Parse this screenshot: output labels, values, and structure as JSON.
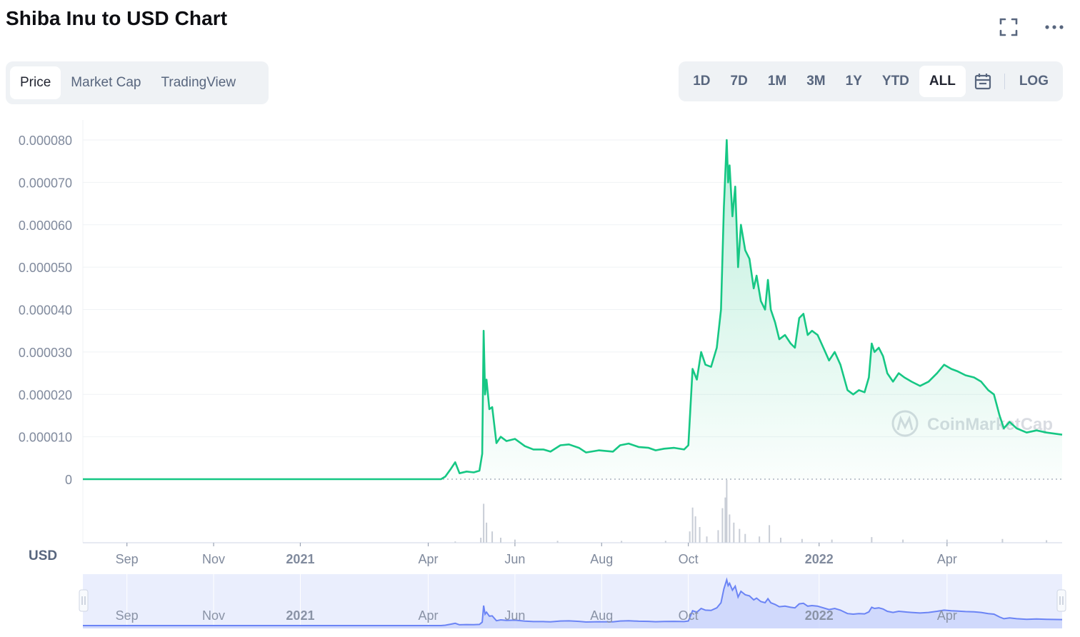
{
  "header": {
    "title": "Shiba Inu to USD Chart"
  },
  "icons": {
    "fullscreen": "fullscreen-icon",
    "more": "more-icon",
    "calendar": "calendar-icon",
    "watermark": "coinmarketcap-logo-icon"
  },
  "tabs": [
    {
      "label": "Price",
      "active": true
    },
    {
      "label": "Market Cap",
      "active": false
    },
    {
      "label": "TradingView",
      "active": false
    }
  ],
  "ranges": [
    {
      "label": "1D",
      "active": false
    },
    {
      "label": "7D",
      "active": false
    },
    {
      "label": "1M",
      "active": false
    },
    {
      "label": "3M",
      "active": false
    },
    {
      "label": "1Y",
      "active": false
    },
    {
      "label": "YTD",
      "active": false
    },
    {
      "label": "ALL",
      "active": true
    }
  ],
  "scale_toggle": "LOG",
  "unit_label": "USD",
  "watermark": "CoinMarketCap",
  "colors": {
    "line": "#16c784",
    "area_top": "#16c784",
    "navigator_line": "#6b84f5",
    "navigator_bg": "#eaeefd",
    "grid": "#eff2f5",
    "axis_text": "#808a9d",
    "volume": "#c8cdd6"
  },
  "chart_data": {
    "type": "area",
    "title": "Shiba Inu to USD Chart",
    "ylabel": "USD",
    "ylim": [
      0,
      8e-05
    ],
    "y_ticks": [
      "0.000080",
      "0.000070",
      "0.000060",
      "0.000050",
      "0.000040",
      "0.000030",
      "0.000020",
      "0.000010",
      "0"
    ],
    "y_tick_values": [
      8e-05,
      7e-05,
      6e-05,
      5e-05,
      4e-05,
      3e-05,
      2e-05,
      1e-05,
      0
    ],
    "x_range": [
      "2020-08-01",
      "2022-06-21"
    ],
    "x_ticks": [
      {
        "date": "2020-09-01",
        "label": "Sep",
        "bold": false
      },
      {
        "date": "2020-11-01",
        "label": "Nov",
        "bold": false
      },
      {
        "date": "2021-01-01",
        "label": "2021",
        "bold": true
      },
      {
        "date": "2021-04-01",
        "label": "Apr",
        "bold": false
      },
      {
        "date": "2021-06-01",
        "label": "Jun",
        "bold": false
      },
      {
        "date": "2021-08-01",
        "label": "Aug",
        "bold": false
      },
      {
        "date": "2021-10-01",
        "label": "Oct",
        "bold": false
      },
      {
        "date": "2022-01-01",
        "label": "2022",
        "bold": true
      },
      {
        "date": "2022-04-01",
        "label": "Apr",
        "bold": false
      }
    ],
    "grid": true,
    "series": [
      {
        "points": [
          [
            "2020-08-01",
            0
          ],
          [
            "2021-04-10",
            0
          ],
          [
            "2021-04-13",
            6e-07
          ],
          [
            "2021-04-17",
            2.5e-06
          ],
          [
            "2021-04-20",
            4e-06
          ],
          [
            "2021-04-23",
            1.4e-06
          ],
          [
            "2021-04-28",
            1.8e-06
          ],
          [
            "2021-05-03",
            1.6e-06
          ],
          [
            "2021-05-07",
            2e-06
          ],
          [
            "2021-05-09",
            6e-06
          ],
          [
            "2021-05-10",
            3.5e-05
          ],
          [
            "2021-05-11",
            2e-05
          ],
          [
            "2021-05-12",
            2.35e-05
          ],
          [
            "2021-05-14",
            1.65e-05
          ],
          [
            "2021-05-16",
            1.7e-05
          ],
          [
            "2021-05-19",
            8.5e-06
          ],
          [
            "2021-05-22",
            1e-05
          ],
          [
            "2021-05-26",
            9e-06
          ],
          [
            "2021-06-01",
            9.5e-06
          ],
          [
            "2021-06-08",
            7.8e-06
          ],
          [
            "2021-06-14",
            7e-06
          ],
          [
            "2021-06-21",
            7e-06
          ],
          [
            "2021-06-26",
            6.5e-06
          ],
          [
            "2021-07-03",
            8e-06
          ],
          [
            "2021-07-09",
            8.2e-06
          ],
          [
            "2021-07-16",
            7.4e-06
          ],
          [
            "2021-07-21",
            6.3e-06
          ],
          [
            "2021-07-30",
            6.8e-06
          ],
          [
            "2021-08-09",
            6.5e-06
          ],
          [
            "2021-08-14",
            8e-06
          ],
          [
            "2021-08-20",
            8.4e-06
          ],
          [
            "2021-08-27",
            7.6e-06
          ],
          [
            "2021-09-03",
            7.4e-06
          ],
          [
            "2021-09-08",
            6.8e-06
          ],
          [
            "2021-09-14",
            7.2e-06
          ],
          [
            "2021-09-21",
            7.4e-06
          ],
          [
            "2021-09-28",
            7e-06
          ],
          [
            "2021-10-01",
            8e-06
          ],
          [
            "2021-10-04",
            2.6e-05
          ],
          [
            "2021-10-07",
            2.35e-05
          ],
          [
            "2021-10-10",
            3e-05
          ],
          [
            "2021-10-13",
            2.7e-05
          ],
          [
            "2021-10-17",
            2.65e-05
          ],
          [
            "2021-10-21",
            3.1e-05
          ],
          [
            "2021-10-24",
            4e-05
          ],
          [
            "2021-10-26",
            6.4e-05
          ],
          [
            "2021-10-28",
            8e-05
          ],
          [
            "2021-10-29",
            7e-05
          ],
          [
            "2021-10-30",
            7.4e-05
          ],
          [
            "2021-11-01",
            6.2e-05
          ],
          [
            "2021-11-03",
            6.9e-05
          ],
          [
            "2021-11-05",
            5e-05
          ],
          [
            "2021-11-07",
            6e-05
          ],
          [
            "2021-11-10",
            5.4e-05
          ],
          [
            "2021-11-13",
            5.2e-05
          ],
          [
            "2021-11-16",
            4.5e-05
          ],
          [
            "2021-11-18",
            4.8e-05
          ],
          [
            "2021-11-21",
            4.2e-05
          ],
          [
            "2021-11-24",
            4e-05
          ],
          [
            "2021-11-26",
            4.7e-05
          ],
          [
            "2021-11-28",
            4e-05
          ],
          [
            "2021-12-01",
            3.7e-05
          ],
          [
            "2021-12-04",
            3.3e-05
          ],
          [
            "2021-12-08",
            3.4e-05
          ],
          [
            "2021-12-12",
            3.2e-05
          ],
          [
            "2021-12-15",
            3.1e-05
          ],
          [
            "2021-12-18",
            3.8e-05
          ],
          [
            "2021-12-21",
            3.9e-05
          ],
          [
            "2021-12-24",
            3.4e-05
          ],
          [
            "2021-12-27",
            3.5e-05
          ],
          [
            "2021-12-31",
            3.4e-05
          ],
          [
            "2022-01-04",
            3.1e-05
          ],
          [
            "2022-01-08",
            2.8e-05
          ],
          [
            "2022-01-12",
            3e-05
          ],
          [
            "2022-01-16",
            2.7e-05
          ],
          [
            "2022-01-21",
            2.1e-05
          ],
          [
            "2022-01-25",
            2e-05
          ],
          [
            "2022-01-29",
            2.1e-05
          ],
          [
            "2022-02-02",
            2.05e-05
          ],
          [
            "2022-02-05",
            2.4e-05
          ],
          [
            "2022-02-07",
            3.2e-05
          ],
          [
            "2022-02-09",
            3e-05
          ],
          [
            "2022-02-12",
            3.1e-05
          ],
          [
            "2022-02-15",
            2.9e-05
          ],
          [
            "2022-02-18",
            2.5e-05
          ],
          [
            "2022-02-22",
            2.3e-05
          ],
          [
            "2022-02-26",
            2.5e-05
          ],
          [
            "2022-03-02",
            2.4e-05
          ],
          [
            "2022-03-07",
            2.3e-05
          ],
          [
            "2022-03-13",
            2.2e-05
          ],
          [
            "2022-03-19",
            2.3e-05
          ],
          [
            "2022-03-25",
            2.5e-05
          ],
          [
            "2022-03-30",
            2.7e-05
          ],
          [
            "2022-04-04",
            2.6e-05
          ],
          [
            "2022-04-08",
            2.55e-05
          ],
          [
            "2022-04-14",
            2.45e-05
          ],
          [
            "2022-04-20",
            2.4e-05
          ],
          [
            "2022-04-25",
            2.3e-05
          ],
          [
            "2022-04-30",
            2.1e-05
          ],
          [
            "2022-05-04",
            2e-05
          ],
          [
            "2022-05-08",
            1.5e-05
          ],
          [
            "2022-05-11",
            1.2e-05
          ],
          [
            "2022-05-15",
            1.35e-05
          ],
          [
            "2022-05-20",
            1.2e-05
          ],
          [
            "2022-05-27",
            1.1e-05
          ],
          [
            "2022-06-03",
            1.15e-05
          ],
          [
            "2022-06-10",
            1.1e-05
          ],
          [
            "2022-06-21",
            1.05e-05
          ]
        ]
      }
    ],
    "volume": {
      "points": [
        [
          "2021-04-20",
          0.02
        ],
        [
          "2021-05-08",
          0.08
        ],
        [
          "2021-05-10",
          0.62
        ],
        [
          "2021-05-12",
          0.32
        ],
        [
          "2021-05-16",
          0.18
        ],
        [
          "2021-05-22",
          0.08
        ],
        [
          "2021-06-01",
          0.05
        ],
        [
          "2021-07-01",
          0.03
        ],
        [
          "2021-08-15",
          0.03
        ],
        [
          "2021-09-15",
          0.03
        ],
        [
          "2021-10-02",
          0.18
        ],
        [
          "2021-10-04",
          0.56
        ],
        [
          "2021-10-06",
          0.42
        ],
        [
          "2021-10-09",
          0.25
        ],
        [
          "2021-10-14",
          0.1
        ],
        [
          "2021-10-22",
          0.2
        ],
        [
          "2021-10-25",
          0.55
        ],
        [
          "2021-10-27",
          0.72
        ],
        [
          "2021-10-28",
          1.0
        ],
        [
          "2021-10-30",
          0.45
        ],
        [
          "2021-11-02",
          0.32
        ],
        [
          "2021-11-06",
          0.22
        ],
        [
          "2021-11-10",
          0.14
        ],
        [
          "2021-11-20",
          0.1
        ],
        [
          "2021-11-27",
          0.28
        ],
        [
          "2021-12-05",
          0.08
        ],
        [
          "2021-12-20",
          0.06
        ],
        [
          "2022-01-10",
          0.05
        ],
        [
          "2022-02-07",
          0.09
        ],
        [
          "2022-03-01",
          0.05
        ],
        [
          "2022-04-01",
          0.05
        ],
        [
          "2022-05-10",
          0.06
        ],
        [
          "2022-06-10",
          0.04
        ]
      ]
    }
  }
}
